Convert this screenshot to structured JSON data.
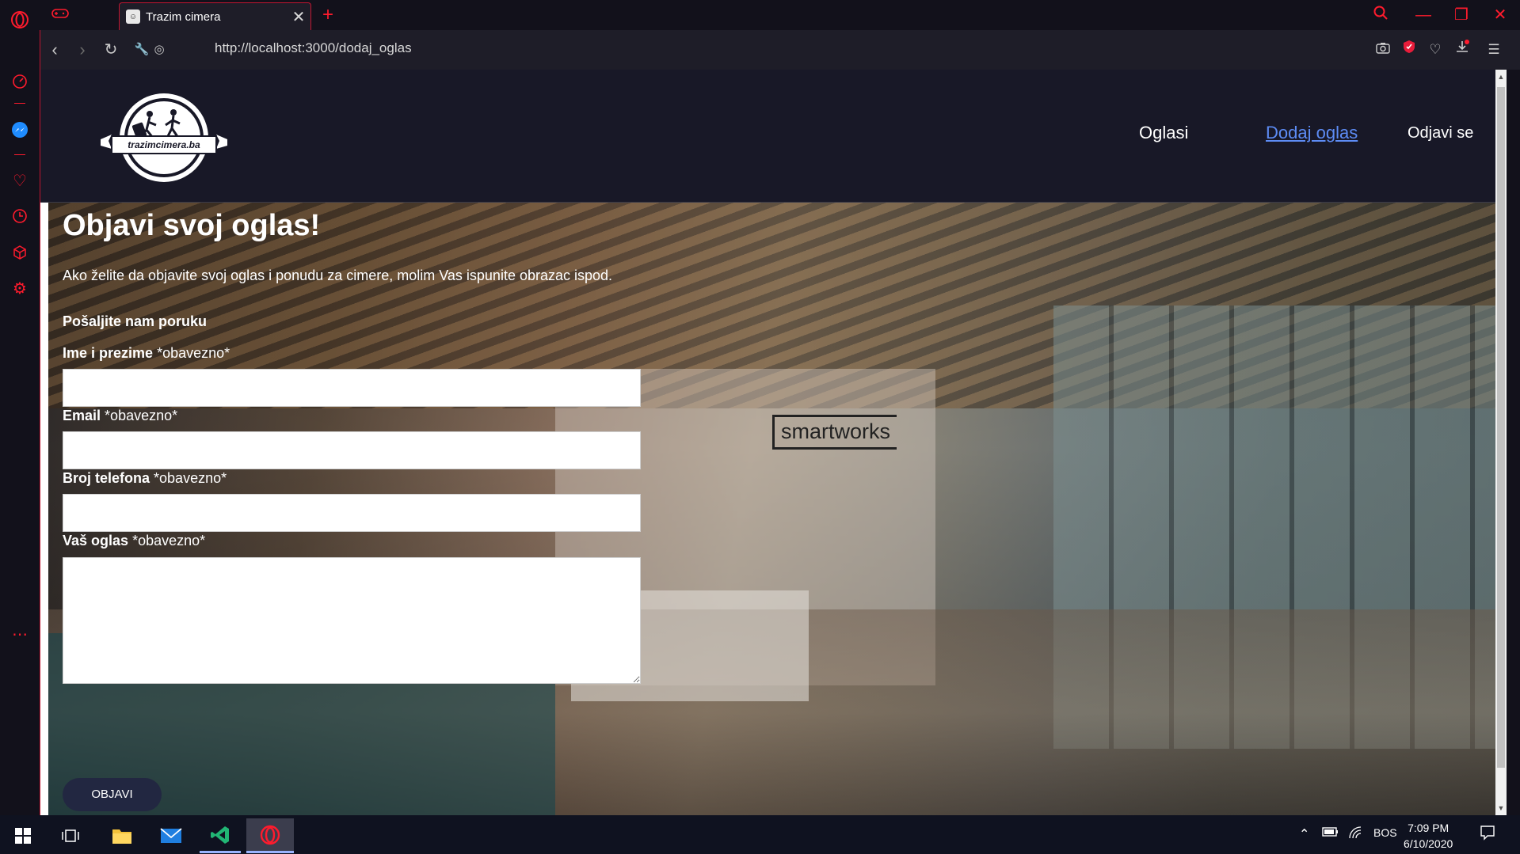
{
  "browser": {
    "tab_title": "Trazim cimera",
    "url": "http://localhost:3000/dodaj_oglas"
  },
  "site": {
    "logo_text": "trazimcimera.ba",
    "nav": [
      {
        "label": "Oglasi",
        "active": false
      },
      {
        "label": "Dodaj oglas",
        "active": true
      },
      {
        "label": "Odjavi se",
        "active": false
      }
    ]
  },
  "hero": {
    "background_sign": "smartworks"
  },
  "form": {
    "title": "Objavi svoj oglas!",
    "intro": "Ako želite da objavite svoj oglas i ponudu za cimere, molim Vas ispunite obrazac ispod.",
    "heading": "Pošaljite nam poruku",
    "fields": [
      {
        "label": "Ime i prezime",
        "required_note": "*obavezno*",
        "value": ""
      },
      {
        "label": "Email",
        "required_note": "*obavezno*",
        "value": ""
      },
      {
        "label": "Broj telefona",
        "required_note": "*obavezno*",
        "value": ""
      },
      {
        "label": "Vaš oglas",
        "required_note": "*obavezno*",
        "value": ""
      }
    ],
    "submit_label": "OBJAVI"
  },
  "taskbar": {
    "language": "BOS",
    "time": "7:09 PM",
    "date": "6/10/2020"
  },
  "colors": {
    "opera_red": "#ff1b2d",
    "header_bg": "#181827",
    "active_nav": "#5d8cf5",
    "submit_bg": "#222741"
  }
}
